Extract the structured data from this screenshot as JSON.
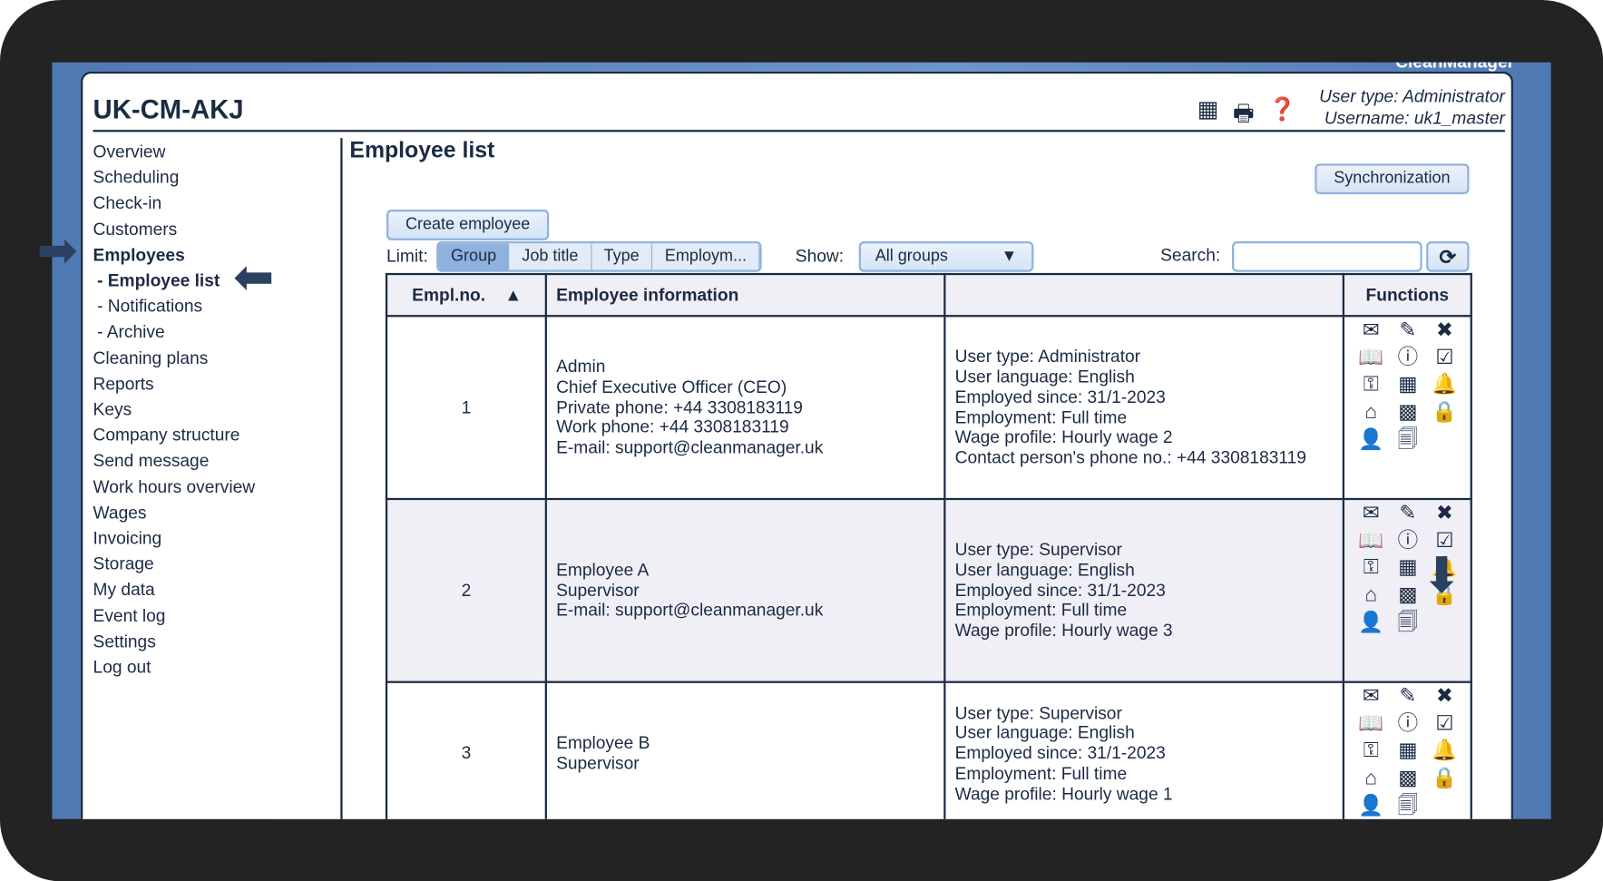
{
  "brand": "CleanManager",
  "title": "UK-CM-AKJ",
  "user": {
    "type": "User type: Administrator",
    "name": "Username: uk1_master"
  },
  "sidebar": [
    "Overview",
    "Scheduling",
    "Check-in",
    "Customers",
    "Employees",
    "- Employee list",
    "- Notifications",
    "- Archive",
    "Cleaning plans",
    "Reports",
    "Keys",
    "Company structure",
    "Send message",
    "Work hours overview",
    "Wages",
    "Invoicing",
    "Storage",
    "My data",
    "Event log",
    "Settings",
    "Log out"
  ],
  "page_title": "Employee list",
  "sync": "Synchronization",
  "create": "Create employee",
  "limit_label": "Limit:",
  "limit_tabs": [
    "Group",
    "Job title",
    "Type",
    "Employm..."
  ],
  "show_label": "Show:",
  "show_value": "All groups",
  "search_label": "Search:",
  "search_value": "",
  "columns": [
    "Empl.no.",
    "Employee information",
    "",
    "Functions"
  ],
  "rows": [
    {
      "no": "1",
      "info": [
        "Admin",
        "Chief Executive Officer (CEO)",
        "Private phone: +44 3308183119",
        "Work phone: +44 3308183119",
        "E-mail: support@cleanmanager.uk"
      ],
      "details": [
        "User type: Administrator",
        "User language: English",
        "Employed since: 31/1-2023",
        "Employment: Full time",
        "Wage profile: Hourly wage 2",
        "Contact person's phone no.: +44 3308183119"
      ]
    },
    {
      "no": "2",
      "info": [
        "Employee A",
        "Supervisor",
        "E-mail: support@cleanmanager.uk"
      ],
      "details": [
        "User type: Supervisor",
        "User language: English",
        "Employed since: 31/1-2023",
        "Employment: Full time",
        "Wage profile: Hourly wage 3"
      ]
    },
    {
      "no": "3",
      "info": [
        "Employee B",
        "Supervisor"
      ],
      "details": [
        "User type: Supervisor",
        "User language: English",
        "Employed since: 31/1-2023",
        "Employment: Full time",
        "Wage profile: Hourly wage 1"
      ]
    }
  ],
  "function_icons": [
    "envelope-icon",
    "pencil-icon",
    "delete-icon",
    "book-icon",
    "info-icon",
    "clipboard-check-icon",
    "key-icon",
    "calendar-icon",
    "bell-icon",
    "home-icon",
    "qr-code-icon",
    "lock-icon",
    "person-icon",
    "documents-icon"
  ]
}
